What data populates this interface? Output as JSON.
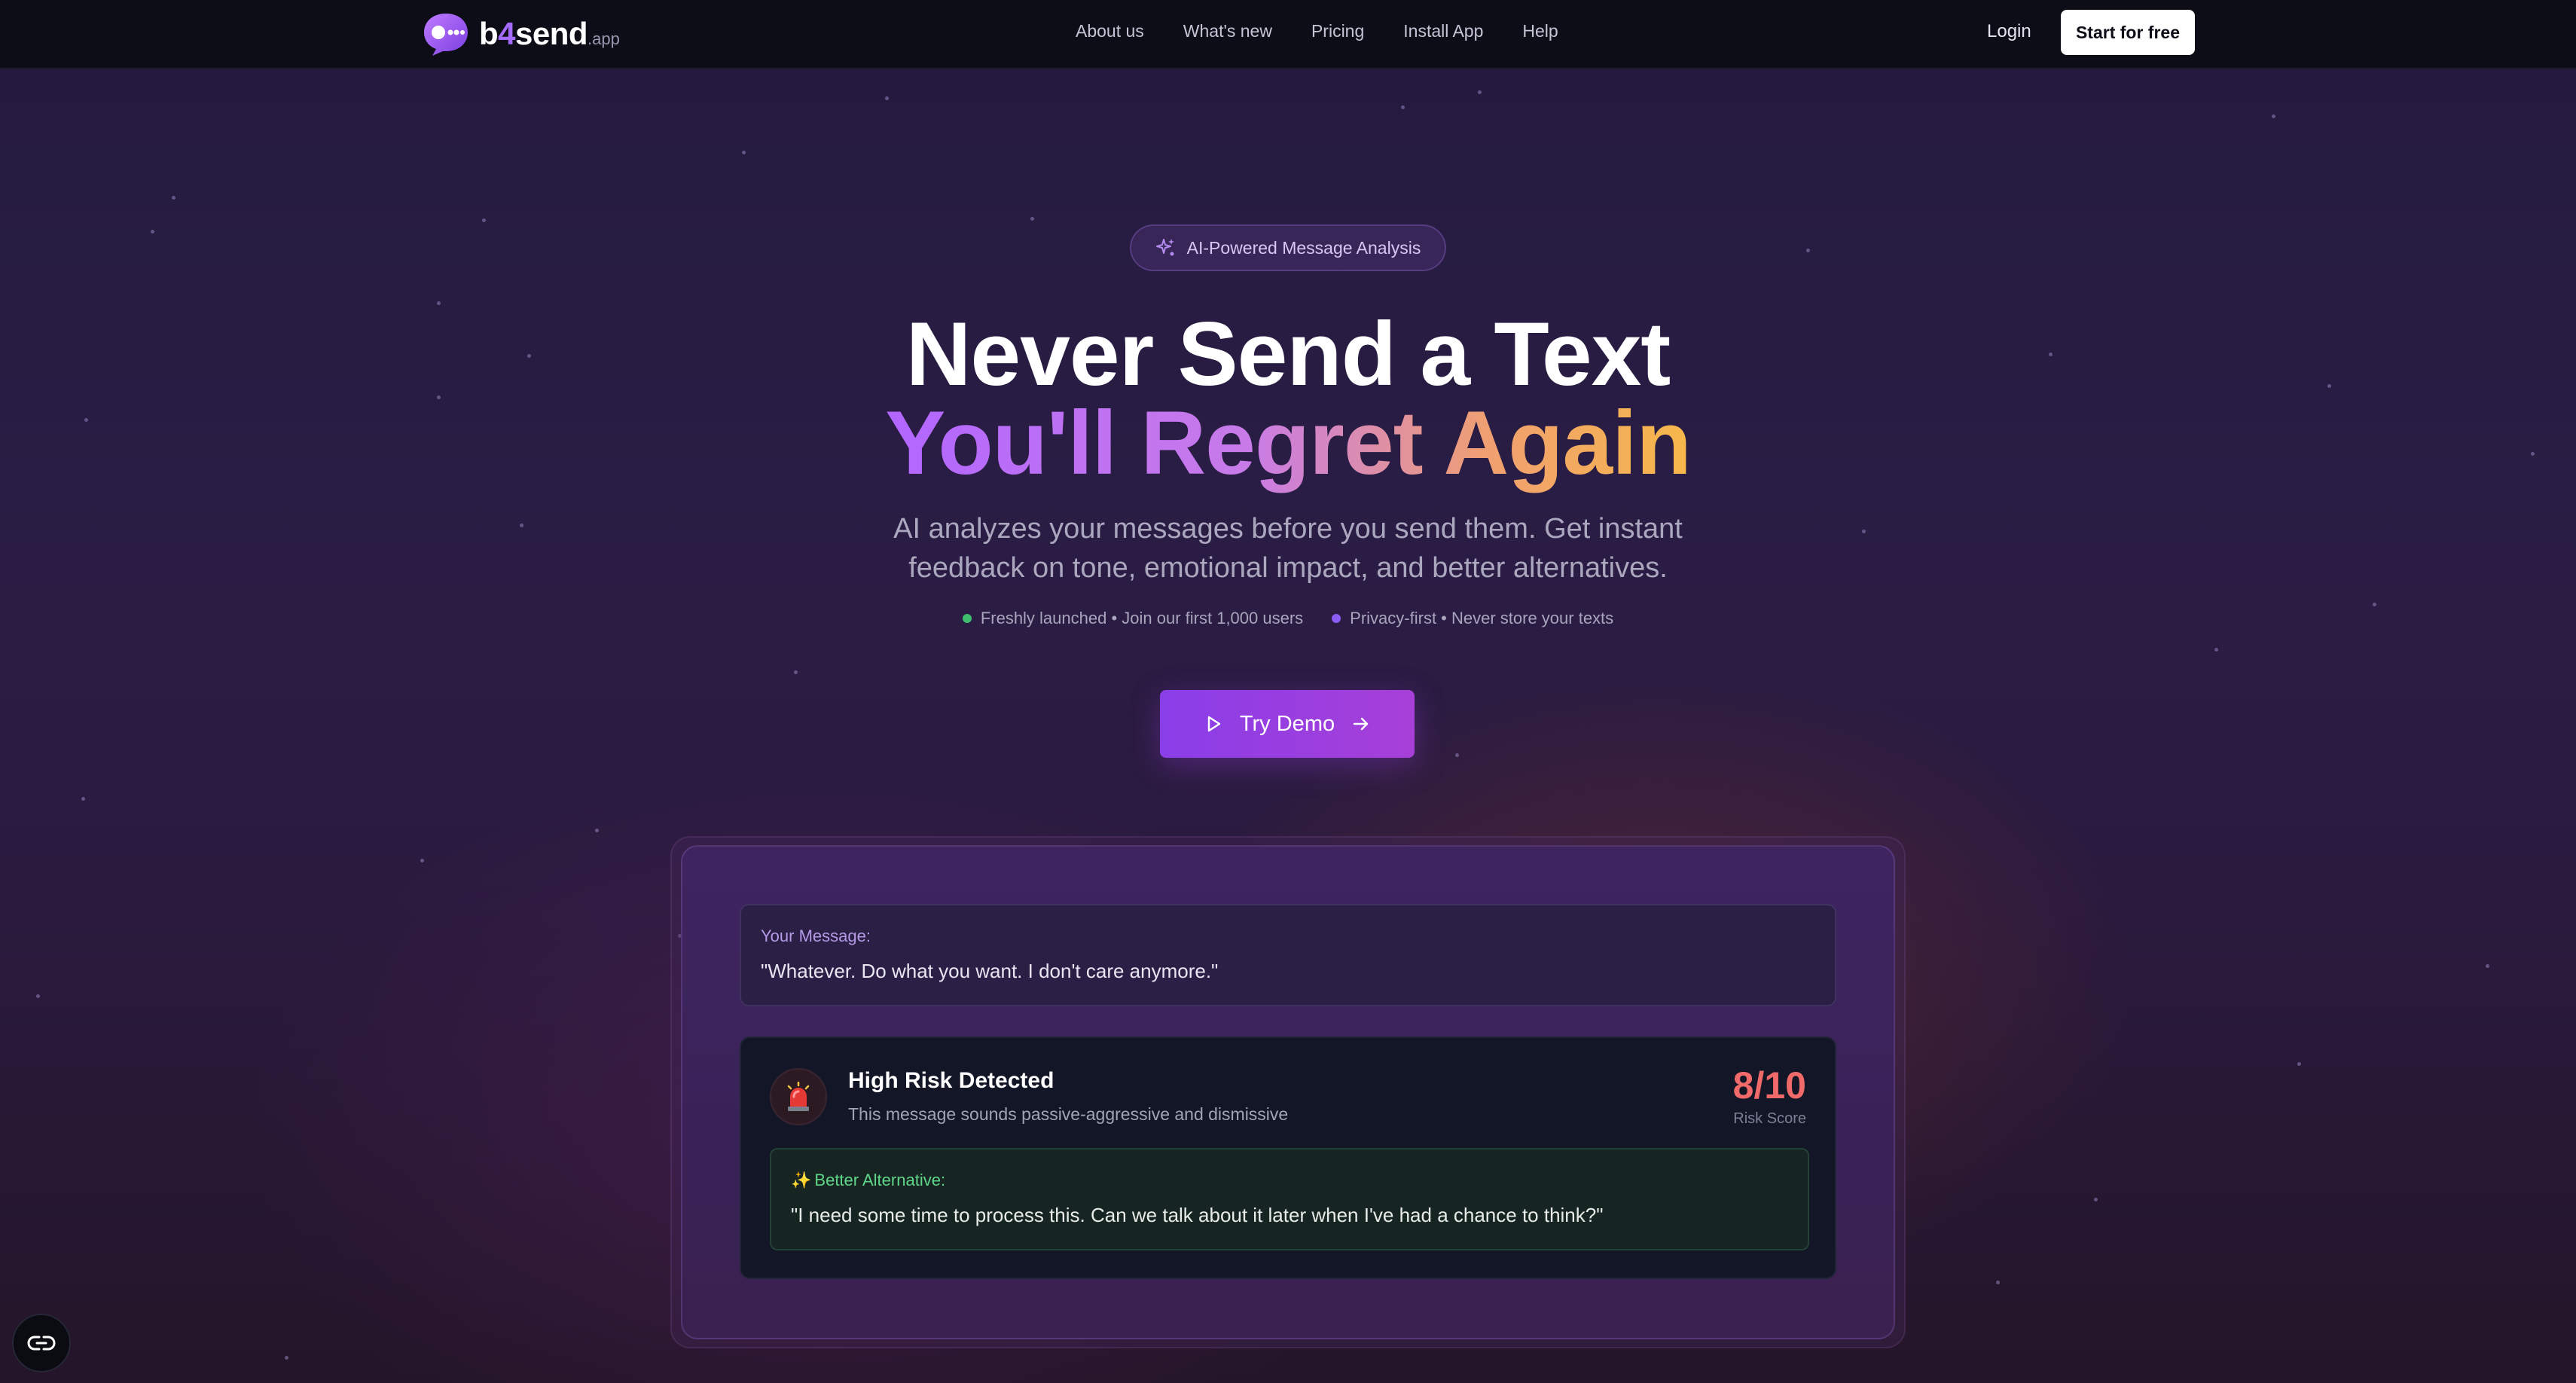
{
  "nav": {
    "logo_main": "b",
    "logo_four": "4",
    "logo_rest": "send",
    "logo_suffix": ".app",
    "links": [
      "About us",
      "What's new",
      "Pricing",
      "Install App",
      "Help"
    ],
    "login": "Login",
    "cta": "Start for free"
  },
  "hero": {
    "badge": "AI-Powered Message Analysis",
    "title_line1": "Never Send a Text",
    "title_line2": "You'll Regret Again",
    "subtitle": "AI analyzes your messages before you send them. Get instant feedback on tone, emotional impact, and better alternatives.",
    "features": [
      {
        "text": "Freshly launched • Join our first 1,000 users",
        "dot_color": "#3fbf6b"
      },
      {
        "text": "Privacy-first • Never store your texts",
        "dot_color": "#8b5cf6"
      }
    ],
    "try_demo": "Try Demo"
  },
  "demo": {
    "message_label": "Your Message:",
    "message_text": "\"Whatever. Do what you want. I don't care anymore.\"",
    "risk_title": "High Risk Detected",
    "risk_desc": "This message sounds passive-aggressive and dismissive",
    "risk_score": "8/10",
    "risk_score_label": "Risk Score",
    "alt_label": "Better Alternative:",
    "alt_text": "\"I need some time to process this. Can we talk about it later when I've had a chance to think?\""
  },
  "colors": {
    "accent": "#8a3ee8",
    "risk": "#f06a6a",
    "success": "#5fd68a"
  },
  "icons": {
    "logo": "chat-bubble-icon",
    "badge": "sparkles-icon",
    "try_demo_left": "play-icon",
    "try_demo_right": "arrow-right-icon",
    "risk": "siren-icon",
    "corner": "link-icon"
  }
}
